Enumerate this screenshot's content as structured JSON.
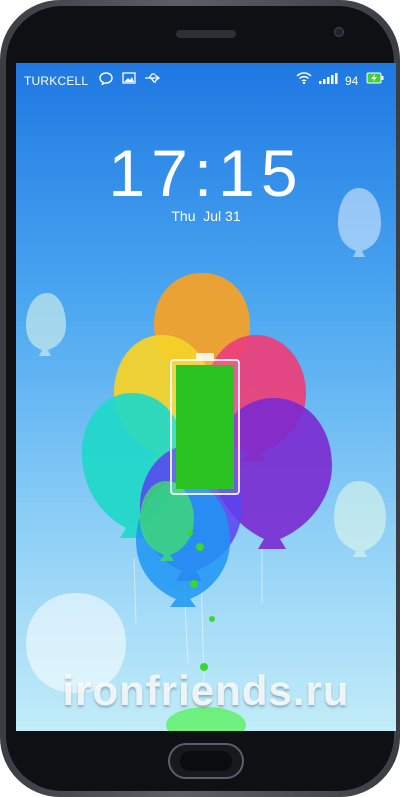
{
  "status_bar": {
    "carrier": "TURKCELL",
    "icons": [
      "message-icon",
      "image-icon",
      "usb-icon",
      "wifi-icon",
      "signal-icon",
      "battery-charging-icon"
    ],
    "battery_percent": "94"
  },
  "lockscreen": {
    "time": "17:15",
    "date": "Thu  Jul 31"
  },
  "charging": {
    "level": 1.0,
    "fill_color": "#2ac321"
  },
  "watermark": "ironfriends.ru",
  "colors": {
    "sky_top": "#1f78e2",
    "sky_bottom": "#c2ecf8",
    "bezel": "#3a3d44"
  }
}
